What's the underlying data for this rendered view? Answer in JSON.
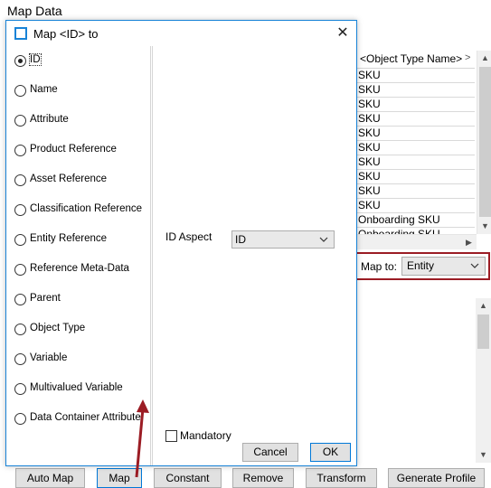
{
  "background": {
    "title": "Map Data",
    "table": {
      "column_header": "<Object Type Name>",
      "rows": [
        "SKU",
        "SKU",
        "SKU",
        "SKU",
        "SKU",
        "SKU",
        "SKU",
        "SKU",
        "SKU",
        "SKU",
        "Onboarding SKU",
        "Onboarding SKU"
      ]
    },
    "map_to": {
      "label": "Map to:",
      "value": "Entity"
    },
    "buttons": [
      "Auto Map",
      "Map",
      "Constant",
      "Remove",
      "Transform",
      "Generate Profile"
    ]
  },
  "dialog": {
    "title": "Map <ID> to",
    "options": [
      "ID",
      "Name",
      "Attribute",
      "Product Reference",
      "Asset Reference",
      "Classification Reference",
      "Entity Reference",
      "Reference Meta-Data",
      "Parent",
      "Object Type",
      "Variable",
      "Multivalued Variable",
      "Data Container Attribute"
    ],
    "selected_option": "ID",
    "id_aspect": {
      "label": "ID Aspect",
      "value": "ID"
    },
    "mandatory_label": "Mandatory",
    "mandatory_checked": false,
    "cancel_label": "Cancel",
    "ok_label": "OK"
  },
  "colors": {
    "accent": "#1883d7",
    "highlight_border": "#9b1c24",
    "arrow": "#9b1c24"
  },
  "icons": {
    "close": "close-icon",
    "window": "window-icon",
    "dropdown": "chevron-down-icon",
    "scroll_up": "scroll-up-icon",
    "scroll_down": "scroll-down-icon",
    "scroll_right": "scroll-right-icon",
    "annotation_arrow": "arrow-up-icon"
  }
}
